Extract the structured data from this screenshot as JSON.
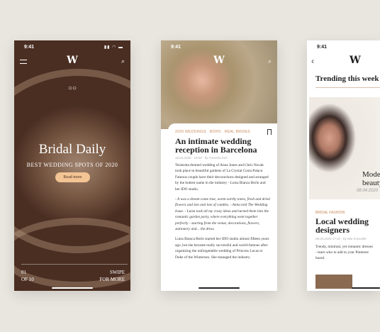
{
  "screen1": {
    "time": "9:41",
    "logo": "W",
    "title": "Bridal Daily",
    "subtitle": "BEST WEDDING SPOTS OF 2020",
    "button": "Read more",
    "page_current": "01",
    "page_total": "OF 10",
    "swipe1": "SWIPE",
    "swipe2": "FOR MORE"
  },
  "screen2": {
    "time": "9:41",
    "logo": "W",
    "tags": [
      "2020 WEDDINGS",
      "BOHO",
      "REAL BRIDES"
    ],
    "title": "An intimate wedding reception in Barcelona",
    "meta": "16.04.2020 · 15:04 · by Amanda Kerr",
    "paragraphs": [
      "Terakotta themed wedding of Anna Jones and Chris Novak took place in beautiful gardens of La Crystal Costa Palace. Famous couple have their decoractions designed and arranged by the hottest name in the industry - Luisa Bianca Berlo and her IDO studio.",
      "- It was a dream come true, warm earthy tones, fresh and dried flowers and lots and lots of candles. - Anna told The Wedding Issue. - Luisa took all my crazy ideas and turned them into the romantic garden party, where everything went together perfectly - starting from the venue, decorations, flowers, stationery and... the dress.",
      "Luisa Bianca Berlo started her IDO studio almost fifteen years ago, but she became really successful and world-famous after organizing the unforgettable wedding of Princess Lucas to Duke of the Winterson. She managed the industry"
    ]
  },
  "screen3": {
    "time": "9:41",
    "logo": "W",
    "section_title": "Trending this week",
    "peek_title": "Mode beauty",
    "peek_date": "08.04.2020",
    "category": "BRIDAL FASHION",
    "title": "Local wedding designers",
    "meta": "06.04.2020 17:32 · by Mia Knoxville",
    "description": "Trendy, minimal, yet romantic dresses - learn who to add to your Pinterest board."
  }
}
